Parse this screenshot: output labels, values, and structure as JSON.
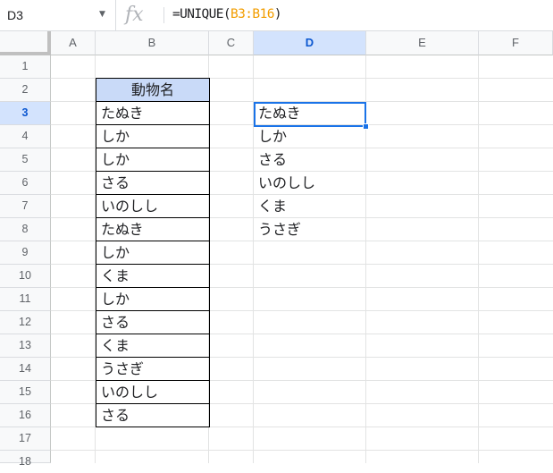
{
  "formula_bar": {
    "name_box": "D3",
    "fx_icon": "fx-icon",
    "formula_prefix": "=UNIQUE(",
    "formula_ref": "B3:B16",
    "formula_suffix": ")"
  },
  "columns": [
    "A",
    "B",
    "C",
    "D",
    "E",
    "F"
  ],
  "active_column": "D",
  "rows": [
    "1",
    "2",
    "3",
    "4",
    "5",
    "6",
    "7",
    "8",
    "9",
    "10",
    "11",
    "12",
    "13",
    "14",
    "15",
    "16",
    "17",
    "18"
  ],
  "active_row": "3",
  "column_b": {
    "header": "動物名",
    "values": [
      "たぬき",
      "しか",
      "しか",
      "さる",
      "いのしし",
      "たぬき",
      "しか",
      "くま",
      "しか",
      "さる",
      "くま",
      "うさぎ",
      "いのしし",
      "さる"
    ]
  },
  "column_d": {
    "values": [
      "たぬき",
      "しか",
      "さる",
      "いのしし",
      "くま",
      "うさぎ"
    ]
  },
  "colors": {
    "header_fill": "#c9daf8",
    "selection": "#1a73e8",
    "formula_ref": "#f29d00"
  }
}
